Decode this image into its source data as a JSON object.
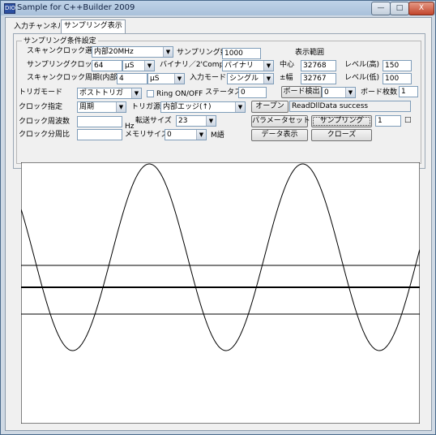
{
  "window": {
    "title": "Sample for C++Builder 2009",
    "app_icon_text": "DIO",
    "minimize_glyph": "—",
    "maximize_glyph": "□",
    "close_glyph": "X"
  },
  "tabs": [
    {
      "label": "入力チャンネル設定"
    },
    {
      "label": "サンプリング表示"
    }
  ],
  "group": {
    "title": "サンプリング条件設定"
  },
  "labels": {
    "scan_clock_select": "スキャンクロック選択",
    "sampling_count": "サンプリング数",
    "display_range": "表示範囲",
    "sampling_clock": "サンプリングクロック",
    "binary_2comp": "バイナリ／2'Comp",
    "center": "中心",
    "level_high": "レベル(高)",
    "scan_clock_period": "スキャンクロック周期(内部)",
    "input_mode": "入力モード",
    "amplitude": "±幅",
    "level_low": "レベル(低)",
    "trigger_mode": "トリガモード",
    "ring_onoff": "Ring ON/OFF",
    "status": "ステータス",
    "board_count": "ボード枚数",
    "clock_spec": "クロック指定",
    "trigger_source": "トリガ源",
    "clock_freq": "クロック周波数",
    "hz": "Hz",
    "transfer_size": "転送サイズ",
    "clock_divider": "クロック分周比",
    "memory_size": "メモリサイズ",
    "m_words": "M語"
  },
  "fields": {
    "scan_clock_select": "内部20MHz",
    "sampling_count": "1000",
    "sampling_clock_value": "64",
    "sampling_clock_unit": "μS",
    "binary_2comp": "バイナリ",
    "center": "32768",
    "level_high": "150",
    "scan_period_value": "4",
    "scan_period_unit": "μS",
    "input_mode": "シングル",
    "amplitude": "32767",
    "level_low": "100",
    "trigger_mode": "ポストトリガ",
    "status": "0",
    "board_detect": "0",
    "board_count": "1",
    "clock_spec": "周期",
    "trigger_source": "内部エッジ(↑)",
    "open_status": "ReadDllData success",
    "clock_freq": "",
    "transfer_size": "23",
    "sampling_count_spin": "1",
    "clock_divider": "",
    "memory_size": "0"
  },
  "buttons": {
    "board_detect": "ボード検出",
    "open": "オープン",
    "param_set": "パラメータセット",
    "sampling": "サンプリング",
    "data_display": "データ表示",
    "close": "クローズ"
  },
  "ring_checked": false,
  "spin_glyph": "□",
  "dropdown_glyph": "▼",
  "plot": {
    "waveform": "sine",
    "cycles_visible": 2.6,
    "horizontal_lines": [
      "level-high",
      "center",
      "level-low"
    ]
  }
}
